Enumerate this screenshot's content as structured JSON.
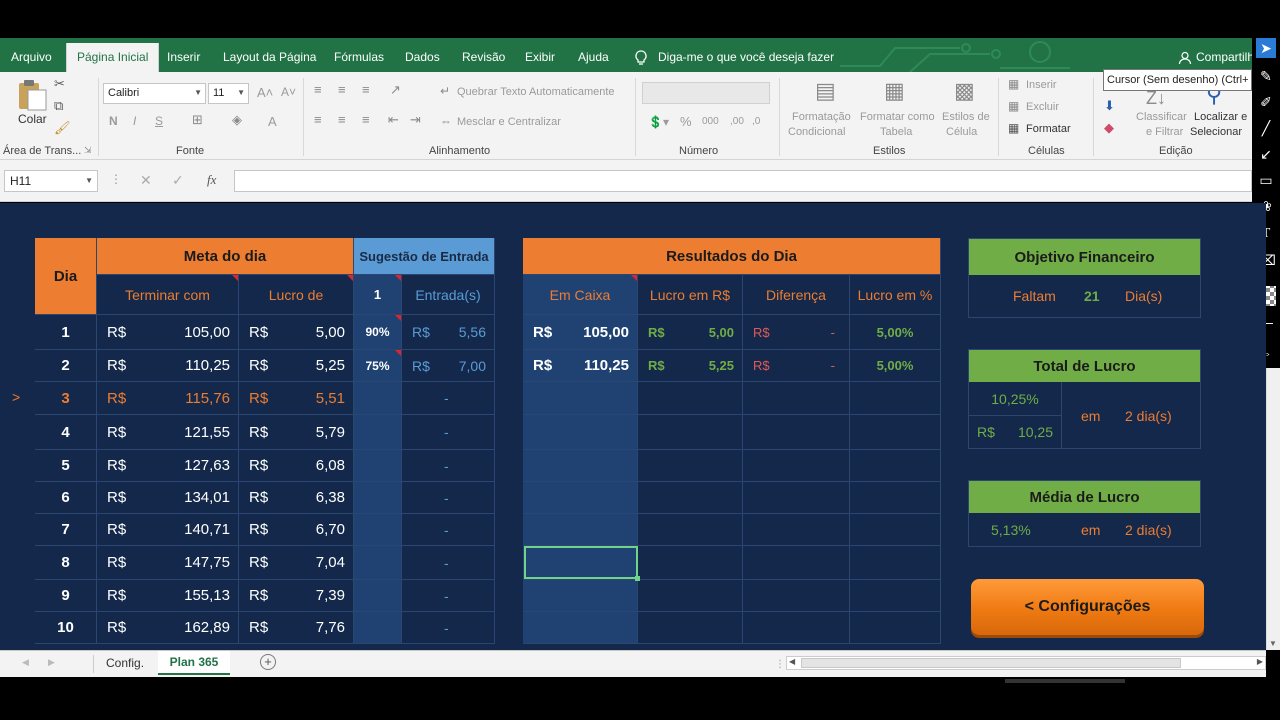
{
  "menu": [
    "Arquivo",
    "Página Inicial",
    "Inserir",
    "Layout da Página",
    "Fórmulas",
    "Dados",
    "Revisão",
    "Exibir",
    "Ajuda",
    "Diga-me o que você deseja fazer"
  ],
  "share_label": "Compartilh",
  "tooltip": "Cursor (Sem desenho) (Ctrl+",
  "ribbon": {
    "paste_label": "Colar",
    "clipboard_label": "Área de Trans...",
    "font_name": "Calibri",
    "font_size": "11",
    "font_label": "Fonte",
    "bold": "N",
    "italic": "I",
    "underline": "S",
    "wrap_text": "Quebrar Texto Automaticamente",
    "merge_center": "Mesclar e Centralizar",
    "alignment_label": "Alinhamento",
    "number_label": "Número",
    "cond_format": [
      "Formatação",
      "Condicional"
    ],
    "format_table": [
      "Formatar como",
      "Tabela"
    ],
    "cell_styles": [
      "Estilos de",
      "Célula"
    ],
    "styles_label": "Estilos",
    "insert": "Inserir",
    "delete": "Excluir",
    "format": "Formatar",
    "cells_label": "Células",
    "sort_filter": [
      "Classificar",
      "e Filtrar"
    ],
    "find_select": [
      "Localizar e",
      "Selecionar"
    ],
    "editing_label": "Edição"
  },
  "formula_bar": {
    "name_box": "H11",
    "fx": "fx",
    "content": ""
  },
  "meta_table": {
    "dia": "Dia",
    "meta_header": "Meta do dia",
    "sug_header": "Sugestão de Entrada",
    "col_terminar": "Terminar com",
    "col_lucro": "Lucro de",
    "col_sug_num": "1",
    "col_entradas": "Entrada(s)",
    "rows": [
      {
        "dia": "1",
        "cur1": "R$",
        "terminar": "105,00",
        "cur2": "R$",
        "lucro": "5,00",
        "pct": "90%",
        "cur3": "R$",
        "entrada": "5,56"
      },
      {
        "dia": "2",
        "cur1": "R$",
        "terminar": "110,25",
        "cur2": "R$",
        "lucro": "5,25",
        "pct": "75%",
        "cur3": "R$",
        "entrada": "7,00"
      },
      {
        "dia": "3",
        "cur1": "R$",
        "terminar": "115,76",
        "cur2": "R$",
        "lucro": "5,51",
        "pct": "",
        "cur3": "",
        "entrada": "-"
      },
      {
        "dia": "4",
        "cur1": "R$",
        "terminar": "121,55",
        "cur2": "R$",
        "lucro": "5,79",
        "pct": "",
        "cur3": "",
        "entrada": "-"
      },
      {
        "dia": "5",
        "cur1": "R$",
        "terminar": "127,63",
        "cur2": "R$",
        "lucro": "6,08",
        "pct": "",
        "cur3": "",
        "entrada": "-"
      },
      {
        "dia": "6",
        "cur1": "R$",
        "terminar": "134,01",
        "cur2": "R$",
        "lucro": "6,38",
        "pct": "",
        "cur3": "",
        "entrada": "-"
      },
      {
        "dia": "7",
        "cur1": "R$",
        "terminar": "140,71",
        "cur2": "R$",
        "lucro": "6,70",
        "pct": "",
        "cur3": "",
        "entrada": "-"
      },
      {
        "dia": "8",
        "cur1": "R$",
        "terminar": "147,75",
        "cur2": "R$",
        "lucro": "7,04",
        "pct": "",
        "cur3": "",
        "entrada": "-"
      },
      {
        "dia": "9",
        "cur1": "R$",
        "terminar": "155,13",
        "cur2": "R$",
        "lucro": "7,39",
        "pct": "",
        "cur3": "",
        "entrada": "-"
      },
      {
        "dia": "10",
        "cur1": "R$",
        "terminar": "162,89",
        "cur2": "R$",
        "lucro": "7,76",
        "pct": "",
        "cur3": "",
        "entrada": "-"
      }
    ],
    "current_marker": ">"
  },
  "results_table": {
    "header": "Resultados do Dia",
    "col_caixa": "Em Caixa",
    "col_lucro_rs": "Lucro em R$",
    "col_diferenca": "Diferença",
    "col_lucro_pct": "Lucro em %",
    "rows": [
      {
        "cur1": "R$",
        "caixa": "105,00",
        "cur2": "R$",
        "lucro": "5,00",
        "cur3": "R$",
        "dif": "-",
        "pct": "5,00%"
      },
      {
        "cur1": "R$",
        "caixa": "110,25",
        "cur2": "R$",
        "lucro": "5,25",
        "cur3": "R$",
        "dif": "-",
        "pct": "5,00%"
      }
    ]
  },
  "objetivo": {
    "header": "Objetivo Financeiro",
    "faltam": "Faltam",
    "num": "21",
    "dias": "Dia(s)"
  },
  "total": {
    "header": "Total de Lucro",
    "pct": "10,25%",
    "cur": "R$",
    "valor": "10,25",
    "em": "em",
    "dias": "2 dia(s)"
  },
  "media": {
    "header": "Média de Lucro",
    "pct": "5,13%",
    "em": "em",
    "dias": "2 dia(s)"
  },
  "config_button": "<  Configurações",
  "sheets": [
    "Config.",
    "Plan 365"
  ],
  "colors": {
    "excel_green": "#217346",
    "navy": "#13284a",
    "orange": "#ed7d31",
    "blue": "#5b9bd5",
    "green": "#70ad47",
    "red": "#e0242a"
  }
}
